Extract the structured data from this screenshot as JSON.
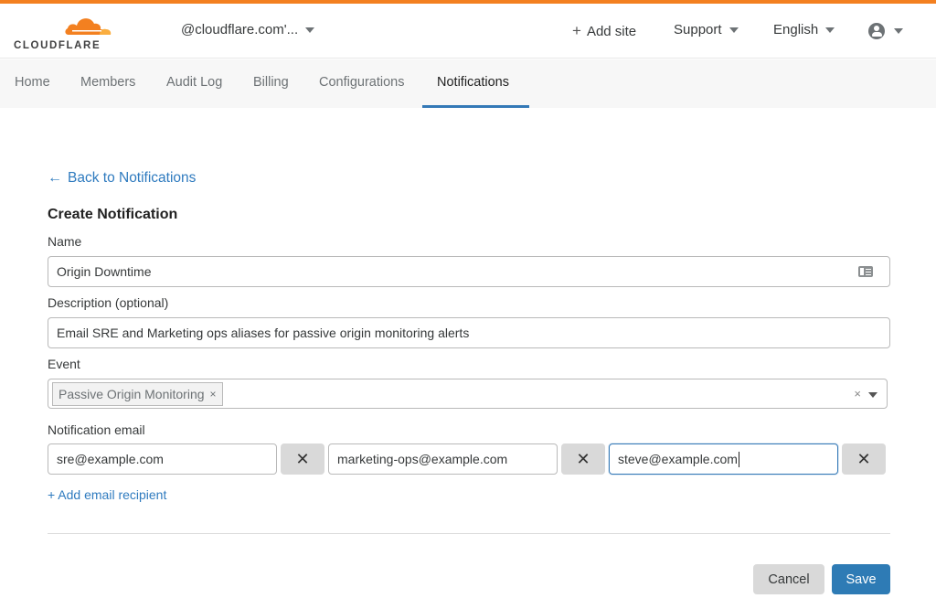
{
  "brand": {
    "name": "CLOUDFLARE",
    "accent_color": "#f38020",
    "link_color": "#2f7bbf",
    "primary_button_color": "#2e7bb5"
  },
  "header": {
    "account_label": "@cloudflare.com'...",
    "add_site_label": "Add site",
    "support_label": "Support",
    "language_label": "English",
    "user_icon": "user-circle-icon"
  },
  "nav": {
    "tabs": [
      {
        "label": "Home",
        "active": false
      },
      {
        "label": "Members",
        "active": false
      },
      {
        "label": "Audit Log",
        "active": false
      },
      {
        "label": "Billing",
        "active": false
      },
      {
        "label": "Configurations",
        "active": false
      },
      {
        "label": "Notifications",
        "active": true
      }
    ]
  },
  "page": {
    "back_link": "Back to Notifications",
    "title": "Create Notification"
  },
  "form": {
    "name": {
      "label": "Name",
      "value": "Origin Downtime"
    },
    "description": {
      "label": "Description (optional)",
      "value": "Email SRE and Marketing ops aliases for passive origin monitoring alerts"
    },
    "event": {
      "label": "Event",
      "selected": [
        "Passive Origin Monitoring"
      ],
      "clear_glyph": "×",
      "tag_remove_glyph": "×"
    },
    "notification_email": {
      "label": "Notification email",
      "recipients": [
        "sre@example.com",
        "marketing-ops@example.com",
        "steve@example.com"
      ],
      "remove_glyph": "✕",
      "add_label": "+ Add email recipient"
    }
  },
  "actions": {
    "cancel_label": "Cancel",
    "save_label": "Save"
  }
}
